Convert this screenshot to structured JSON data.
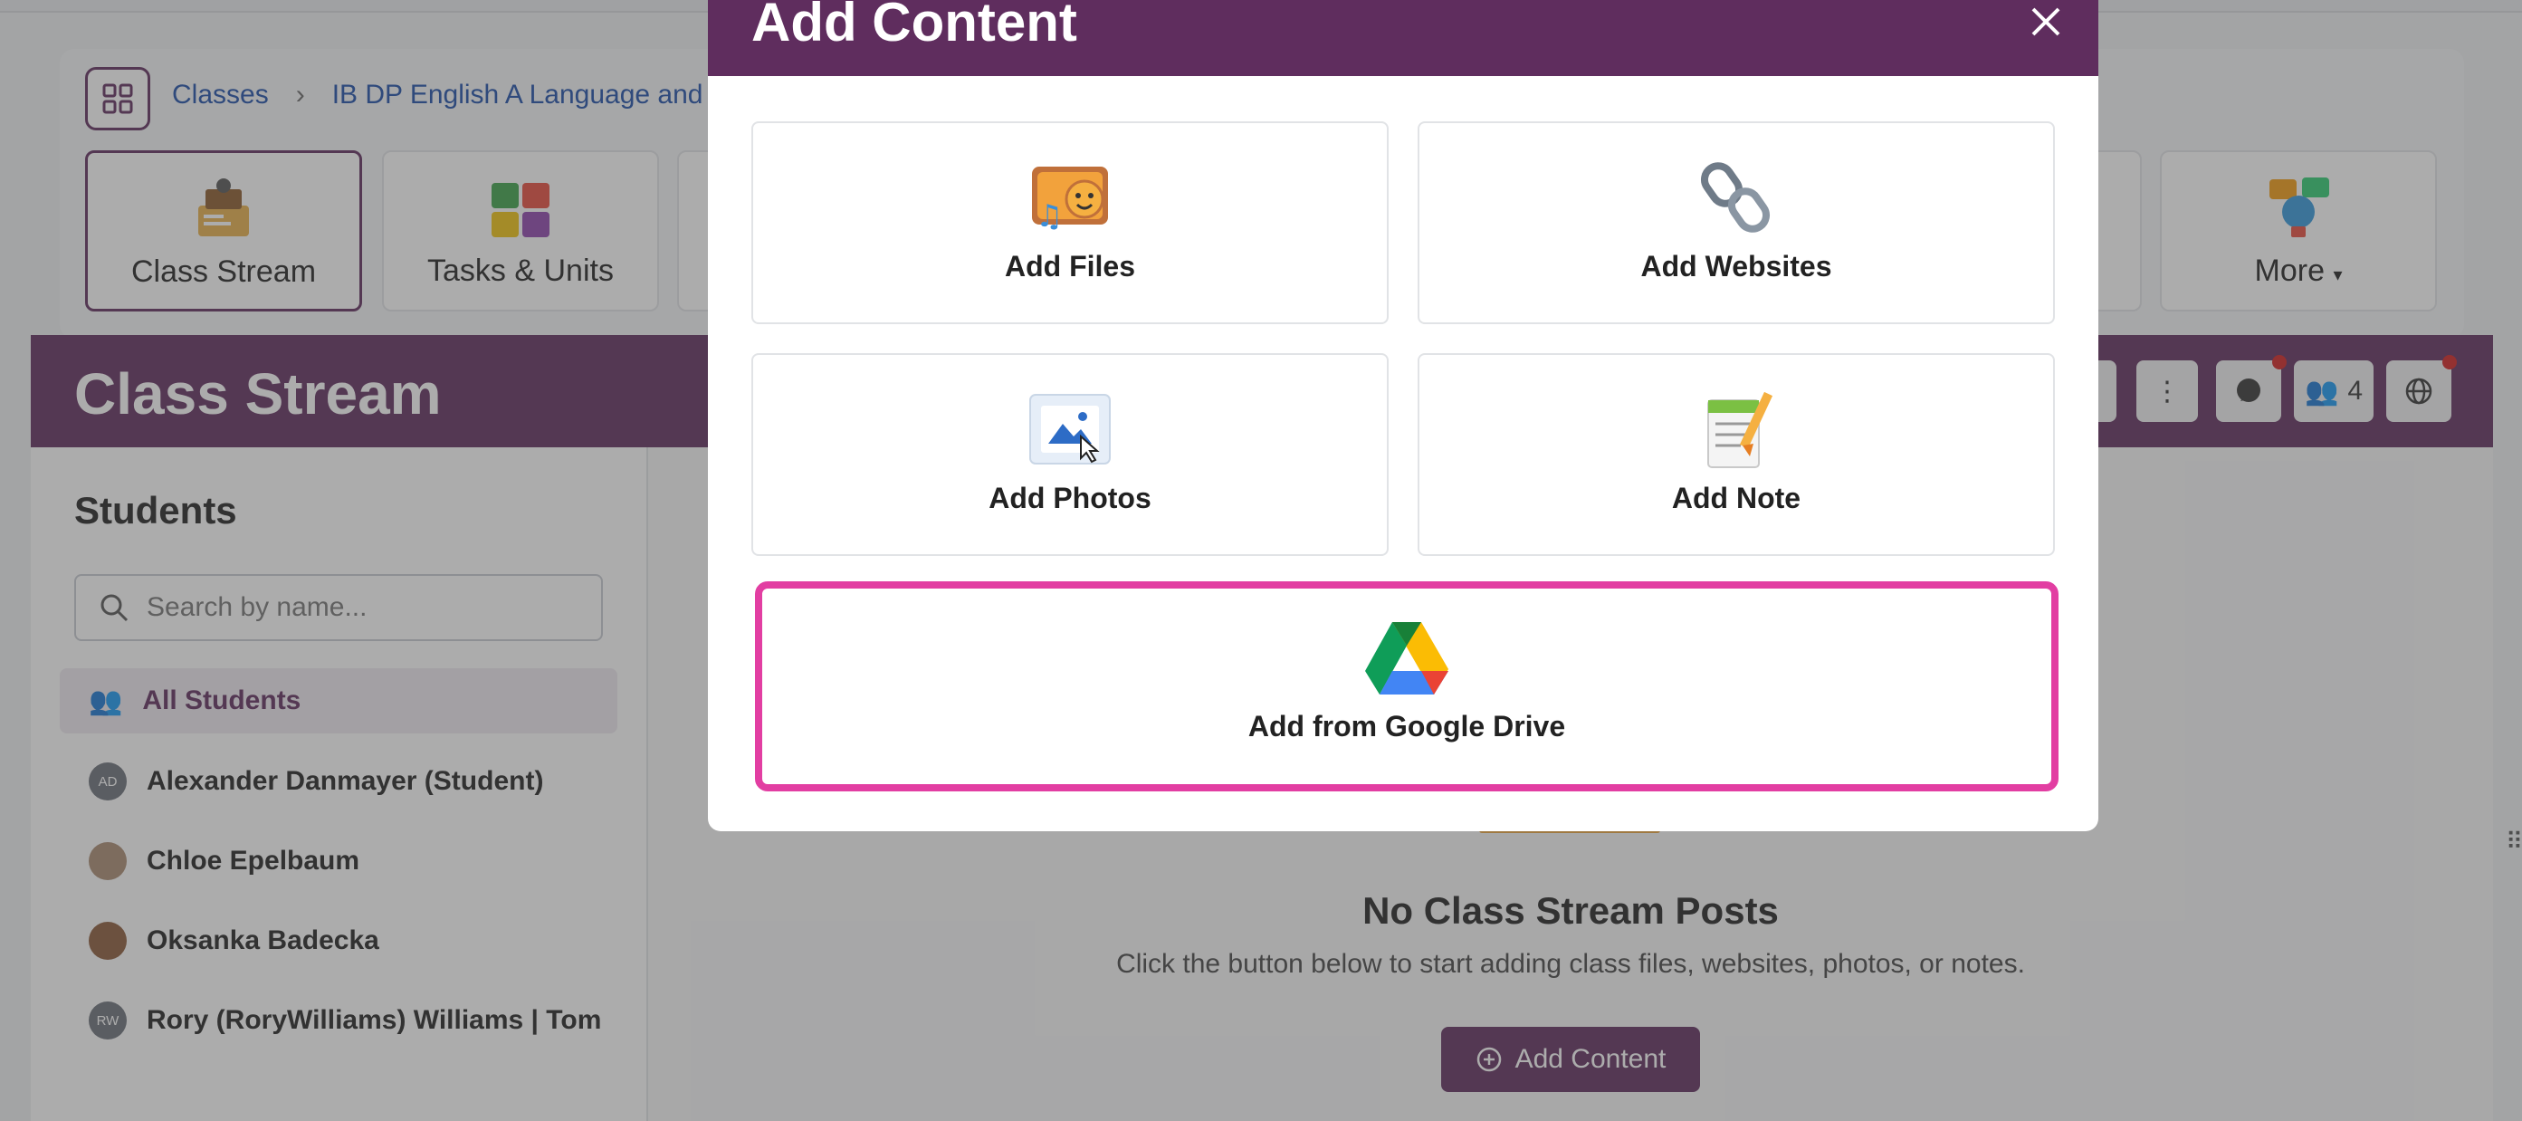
{
  "breadcrumb": {
    "root": "Classes",
    "current": "IB DP English A Language and Lite"
  },
  "nav_tiles": [
    {
      "label": "Class Stream",
      "icon": "class-stream-icon"
    },
    {
      "label": "Tasks & Units",
      "icon": "puzzle-icon"
    },
    {
      "label": "More",
      "icon": "more-lightbulb-icon"
    }
  ],
  "banner": {
    "title": "Class Stream",
    "members_count": "4"
  },
  "sidebar": {
    "title": "Students",
    "search_placeholder": "Search by name...",
    "all_students": "All Students",
    "students": [
      {
        "name": "Alexander Danmayer (Student)",
        "initials": "AD"
      },
      {
        "name": "Chloe Epelbaum",
        "initials": ""
      },
      {
        "name": "Oksanka Badecka",
        "initials": ""
      },
      {
        "name": "Rory (RoryWilliams) Williams | Tom",
        "initials": "RW"
      }
    ]
  },
  "main": {
    "empty_title": "No Class Stream Posts",
    "empty_desc": "Click the button below to start adding class files, websites, photos, or notes.",
    "add_button": "Add Content"
  },
  "modal": {
    "title": "Add Content",
    "options": {
      "files": "Add Files",
      "websites": "Add Websites",
      "photos": "Add Photos",
      "note": "Add Note",
      "drive": "Add from Google Drive"
    }
  },
  "colors": {
    "brand": "#5f2d5e",
    "highlight": "#e23ea2",
    "accent": "#e8a33d"
  }
}
